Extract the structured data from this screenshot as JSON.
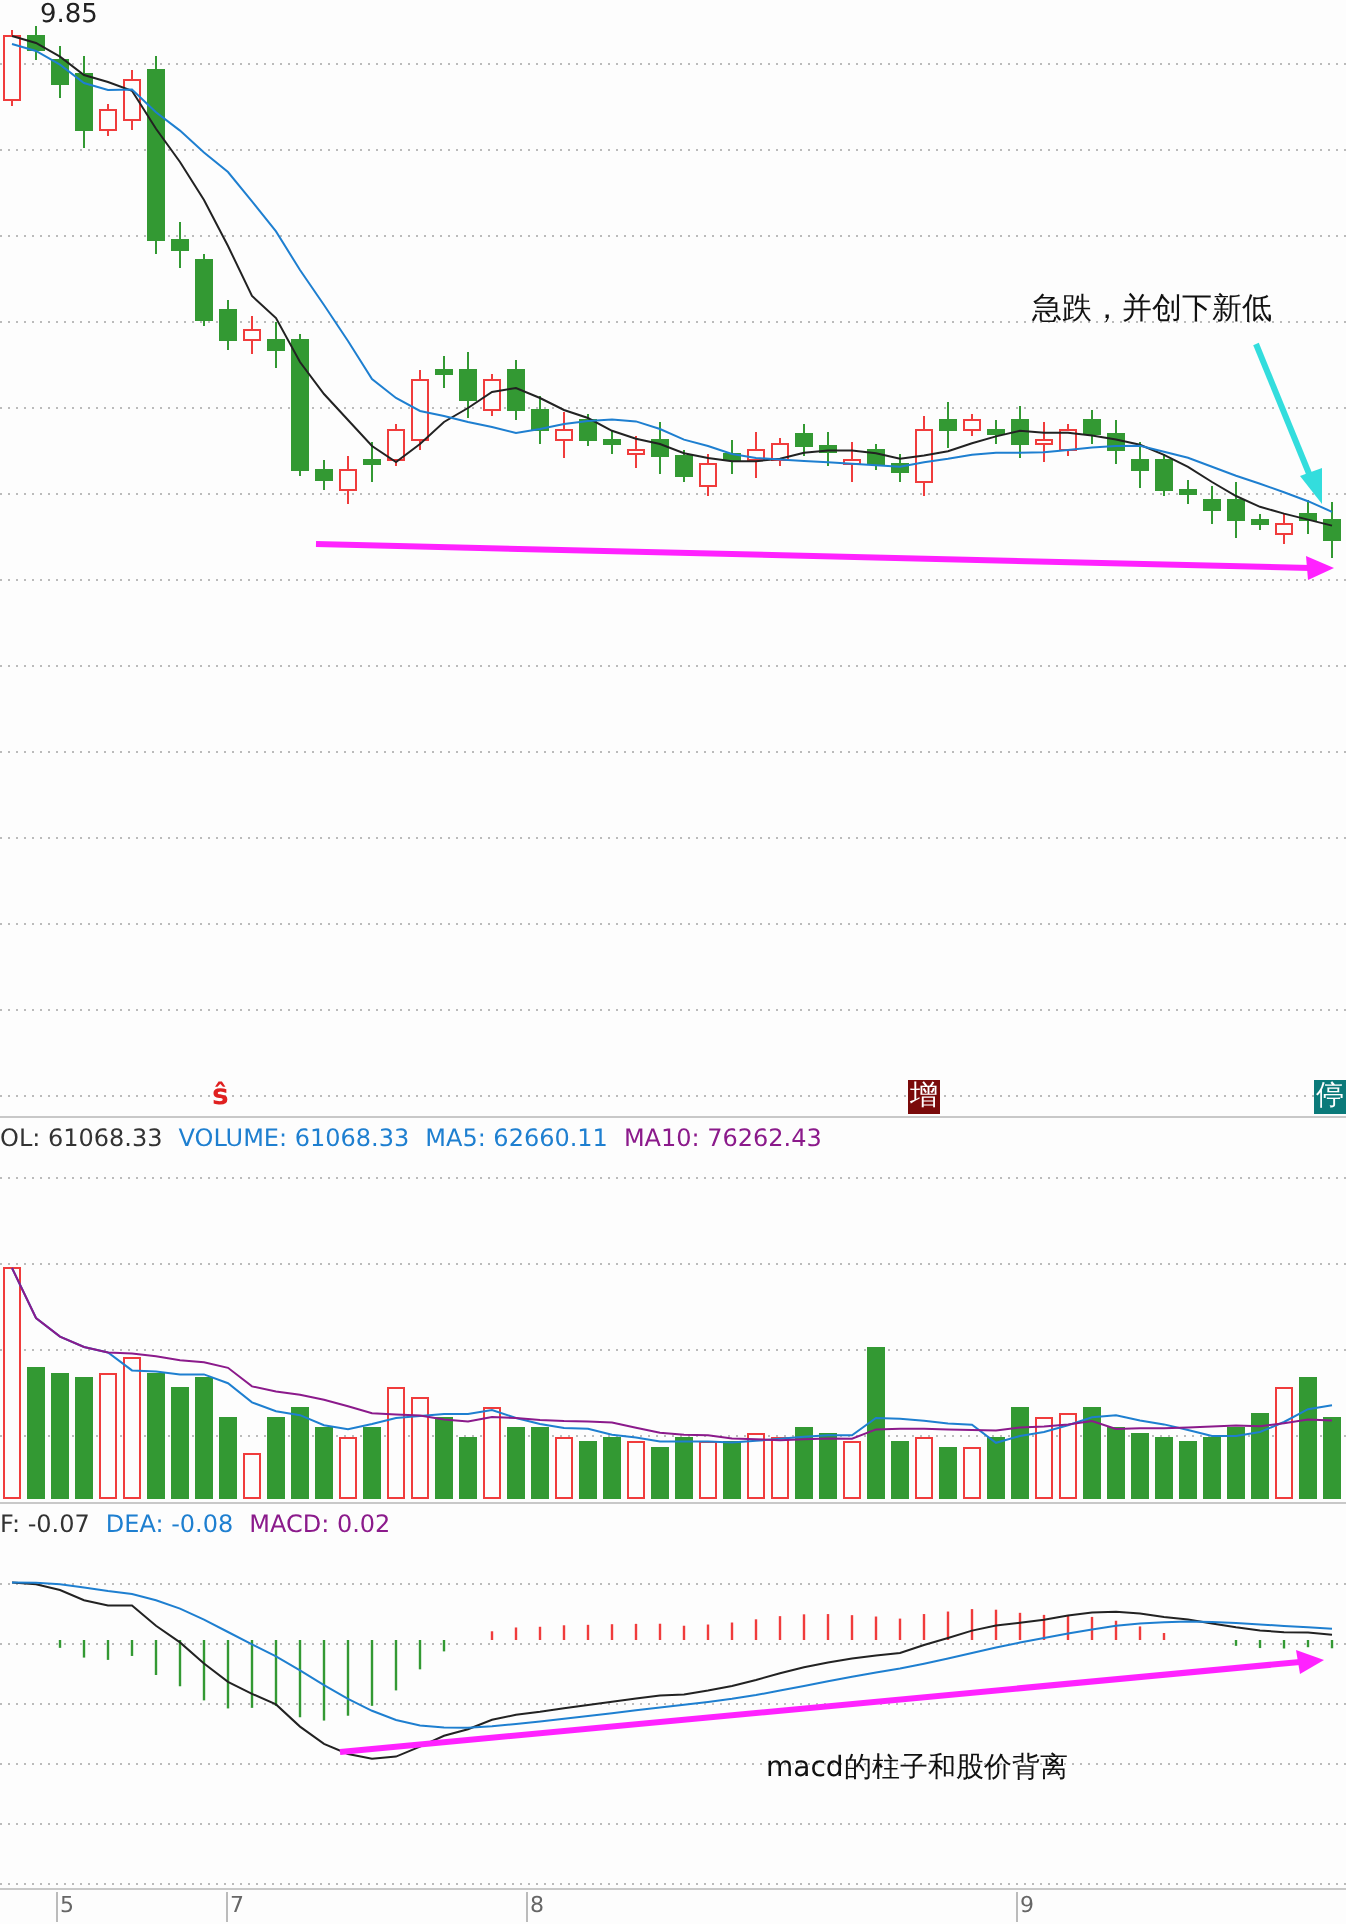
{
  "price_panel": {
    "high_label": "9.85",
    "annotation": "急跌，并创下新低",
    "markers": [
      {
        "kind": "text",
        "text": "ŝ",
        "color": "#e02020"
      },
      {
        "kind": "box",
        "text": "增",
        "color": "#7a0a0a"
      },
      {
        "kind": "box",
        "text": "停",
        "color": "#0b7a7a"
      }
    ]
  },
  "volume_panel": {
    "legend": [
      {
        "text": "OL: 61068.33",
        "color": "#333333"
      },
      {
        "text": "VOLUME: 61068.33",
        "color": "#1e7fd0"
      },
      {
        "text": "MA5: 62660.11",
        "color": "#1e7fd0"
      },
      {
        "text": "MA10: 76262.43",
        "color": "#8b1a8b"
      }
    ]
  },
  "macd_panel": {
    "legend": [
      {
        "text": "F: -0.07",
        "color": "#333333"
      },
      {
        "text": "DEA: -0.08",
        "color": "#1e7fd0"
      },
      {
        "text": "MACD: 0.02",
        "color": "#8b1a8b"
      }
    ],
    "annotation": "macd的柱子和股价背离"
  },
  "time_axis": {
    "labels": [
      "5",
      "7",
      "8",
      "9"
    ]
  }
}
